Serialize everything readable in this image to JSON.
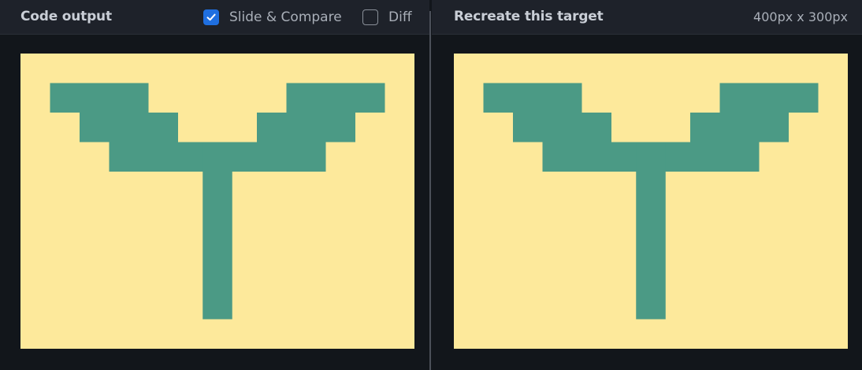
{
  "left_panel": {
    "title": "Code output",
    "slide_compare": {
      "label": "Slide & Compare",
      "checked": true
    },
    "diff": {
      "label": "Diff",
      "checked": false
    }
  },
  "right_panel": {
    "title": "Recreate this target",
    "dimensions": "400px x 300px"
  },
  "colors": {
    "background": "#fde99b",
    "shape": "#4b9a85",
    "checkbox_accent": "#1f6fe0"
  },
  "icons": {
    "check": "check-icon"
  }
}
